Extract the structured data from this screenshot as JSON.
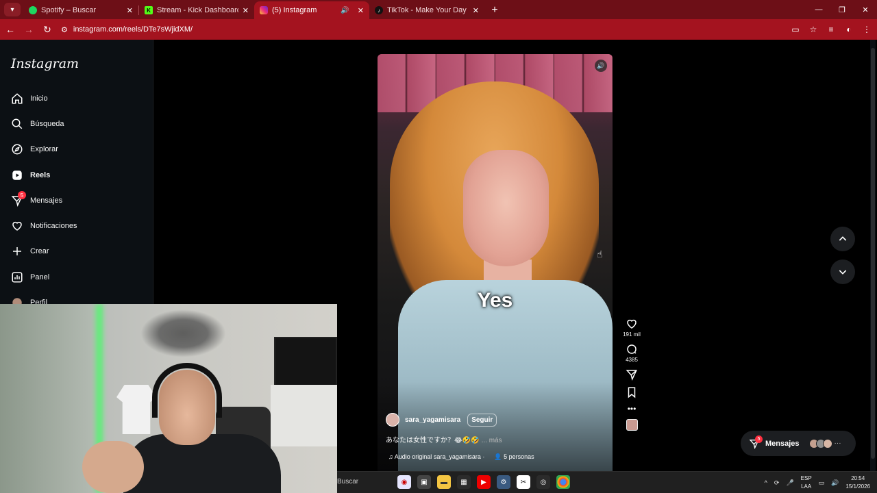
{
  "browser": {
    "tabs": [
      {
        "title": "Spotify – Buscar",
        "favicon": "spotify-icon",
        "color": "#1ed760",
        "active": false
      },
      {
        "title": "Stream - Kick Dashboard",
        "favicon": "kick-icon",
        "color": "#53fc18",
        "active": false
      },
      {
        "title": "(5) Instagram",
        "favicon": "instagram-icon",
        "color": "#e1306c",
        "active": true
      },
      {
        "title": "TikTok - Make Your Day",
        "favicon": "tiktok-icon",
        "color": "#000000",
        "active": false
      }
    ],
    "url": "instagram.com/reels/DTe7sWjidXM/",
    "accent": "#a4131f"
  },
  "sidebar": {
    "logo": "Instagram",
    "items": [
      {
        "label": "Inicio",
        "icon": "home-icon"
      },
      {
        "label": "Búsqueda",
        "icon": "search-icon"
      },
      {
        "label": "Explorar",
        "icon": "compass-icon"
      },
      {
        "label": "Reels",
        "icon": "reels-icon",
        "active": true
      },
      {
        "label": "Mensajes",
        "icon": "messages-icon",
        "badge": "5"
      },
      {
        "label": "Notificaciones",
        "icon": "heart-icon"
      },
      {
        "label": "Crear",
        "icon": "plus-icon"
      },
      {
        "label": "Panel",
        "icon": "dashboard-icon"
      },
      {
        "label": "Perfil",
        "icon": "profile-icon"
      }
    ]
  },
  "reel": {
    "caption_overlay": "Yes",
    "username": "sara_yagamisara",
    "follow_label": "Seguir",
    "description": "あなたは女性ですか？😂🤣🤣",
    "more_label": "... más",
    "audio_label": "Audio original",
    "audio_user": "sara_yagamisara ·",
    "people_label": "5 personas",
    "likes": "191 mil",
    "comments": "4385"
  },
  "messages_pill": {
    "label": "Mensajes",
    "badge": "5"
  },
  "taskbar": {
    "search_label": "Buscar",
    "lang_1": "ESP",
    "lang_2": "LAA",
    "time": "20:54",
    "date": "15/1/2026"
  }
}
